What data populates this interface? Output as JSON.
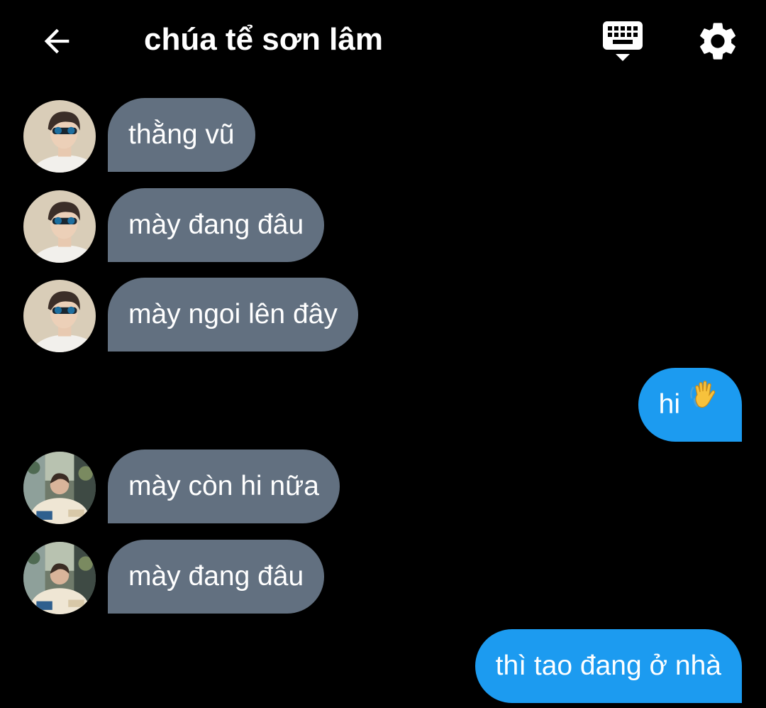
{
  "header": {
    "title": "chúa tể sơn lâm",
    "back_icon": "arrow-left-icon",
    "keyboard_icon": "keyboard-icon",
    "settings_icon": "gear-icon"
  },
  "colors": {
    "background": "#000000",
    "incoming_bubble": "#627080",
    "outgoing_bubble": "#1c9bf0",
    "text": "#ffffff"
  },
  "messages": [
    {
      "direction": "incoming",
      "text": "thằng vũ",
      "avatar": "avatar-sunglasses"
    },
    {
      "direction": "incoming",
      "text": "mày đang đâu",
      "avatar": "avatar-sunglasses"
    },
    {
      "direction": "incoming",
      "text": "mày ngoi lên đây",
      "avatar": "avatar-sunglasses"
    },
    {
      "direction": "outgoing",
      "text": "hi",
      "emoji": "waving-hand-icon"
    },
    {
      "direction": "incoming",
      "text": "mày còn hi nữa",
      "avatar": "avatar-cafe"
    },
    {
      "direction": "incoming",
      "text": "mày đang đâu",
      "avatar": "avatar-cafe"
    },
    {
      "direction": "outgoing",
      "text": "thì tao đang ở nhà"
    }
  ]
}
